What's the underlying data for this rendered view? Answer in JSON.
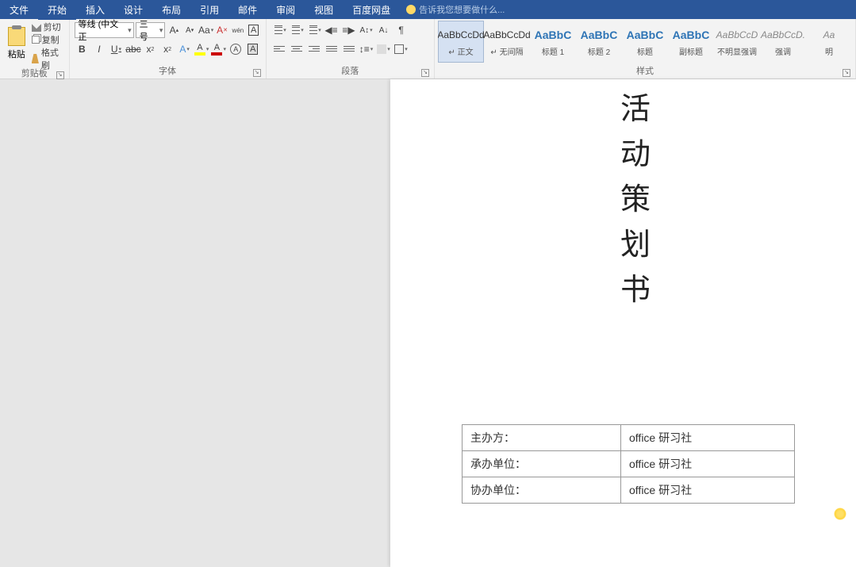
{
  "menu": {
    "file": "文件",
    "tabs": [
      "开始",
      "插入",
      "设计",
      "布局",
      "引用",
      "邮件",
      "审阅",
      "视图",
      "百度网盘"
    ],
    "tell_me": "告诉我您想要做什么..."
  },
  "clipboard": {
    "paste": "粘贴",
    "cut": "剪切",
    "copy": "复制",
    "format_painter": "格式刷",
    "label": "剪贴板"
  },
  "font": {
    "name": "等线 (中文正",
    "size": "三号",
    "label": "字体",
    "grow": "A",
    "shrink": "A",
    "changecase": "Aa",
    "clear": "A",
    "pinyin": "wén",
    "charborder": "A",
    "bold": "B",
    "italic": "I",
    "underline": "U",
    "strike": "abc",
    "sub": "x",
    "sup": "x",
    "effects": "A",
    "highlight": "A",
    "color": "A",
    "circled": "A",
    "A": "A"
  },
  "paragraph": {
    "label": "段落"
  },
  "styles": {
    "label": "样式",
    "items": [
      {
        "preview": "AaBbCcDd",
        "name": "↵ 正文",
        "cls": ""
      },
      {
        "preview": "AaBbCcDd",
        "name": "↵ 无间隔",
        "cls": ""
      },
      {
        "preview": "AaBbC",
        "name": "标题 1",
        "cls": "heading big"
      },
      {
        "preview": "AaBbC",
        "name": "标题 2",
        "cls": "heading big"
      },
      {
        "preview": "AaBbC",
        "name": "标题",
        "cls": "heading big"
      },
      {
        "preview": "AaBbC",
        "name": "副标题",
        "cls": "heading big"
      },
      {
        "preview": "AaBbCcD",
        "name": "不明显强调",
        "cls": "light"
      },
      {
        "preview": "AaBbCcD.",
        "name": "强调",
        "cls": "light"
      },
      {
        "preview": "Aa",
        "name": "明",
        "cls": "light"
      }
    ]
  },
  "document": {
    "title_chars": [
      "活",
      "动",
      "策",
      "划",
      "书"
    ],
    "table": [
      {
        "label": "主办方：",
        "value": "office 研习社"
      },
      {
        "label": "承办单位：",
        "value": "office 研习社"
      },
      {
        "label": "协办单位：",
        "value": "office 研习社"
      }
    ]
  }
}
